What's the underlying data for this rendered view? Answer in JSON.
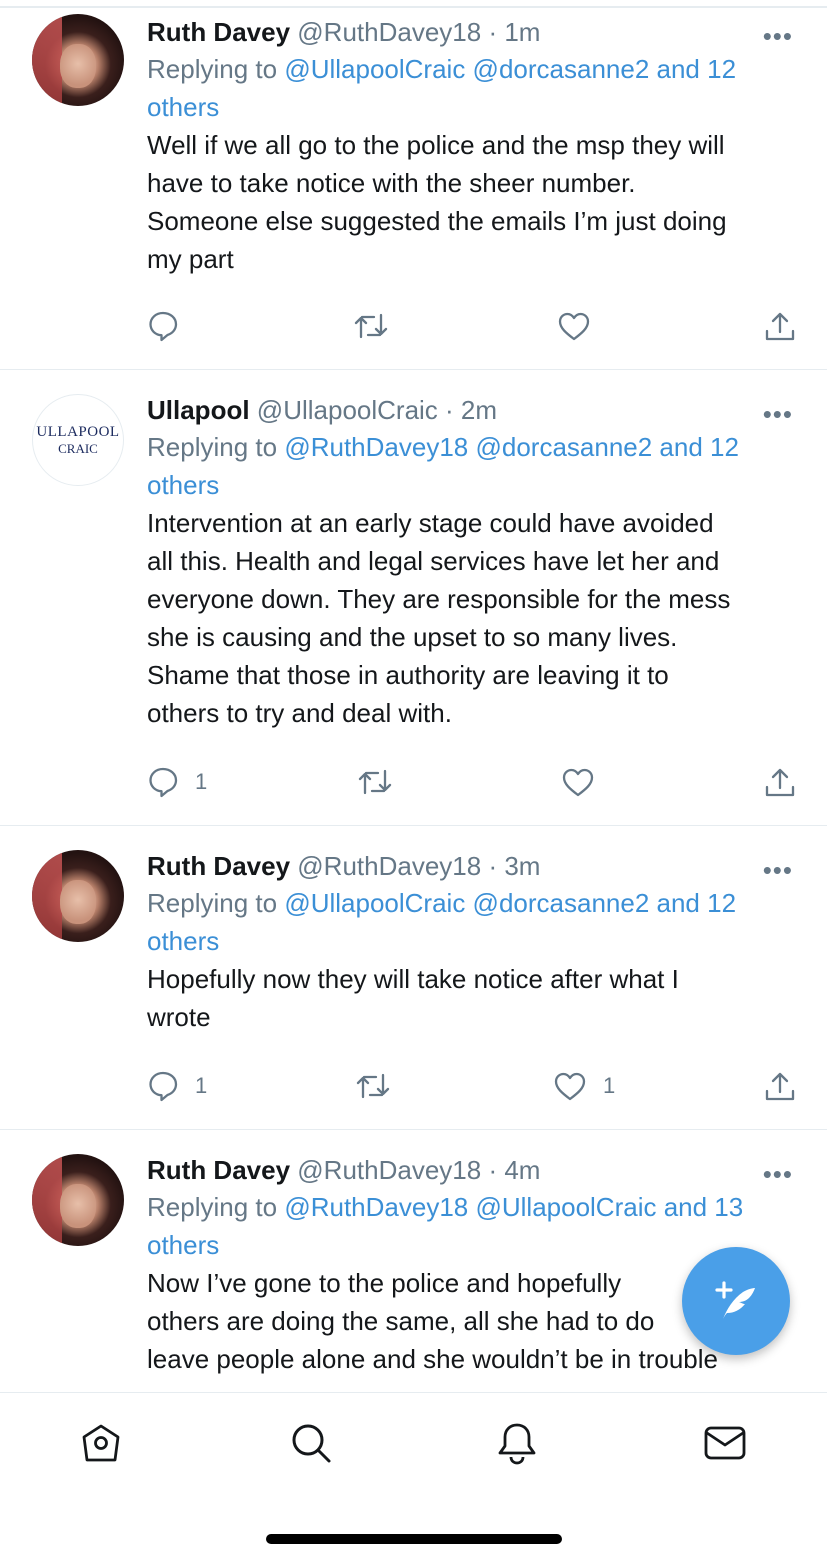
{
  "tweets": [
    {
      "name": "Ruth Davey",
      "handle": "@RuthDavey18",
      "time": "· 1m",
      "reply_prefix": "Replying to",
      "mentions": "@UllapoolCraic @dorcasanne2 and 12",
      "mentions_line2": "others",
      "lines": [
        "Well if we all go to the police and the msp they will",
        "have to take notice with the sheer number.",
        "Someone else suggested the emails I’m just doing",
        "my part"
      ],
      "reply_count": "",
      "like_count": "",
      "avatar": "ruth-avatar"
    },
    {
      "name": "Ullapool",
      "handle": "@UllapoolCraic",
      "time": "· 2m",
      "reply_prefix": "Replying to",
      "mentions": "@RuthDavey18 @dorcasanne2 and 12",
      "mentions_line2": "others",
      "lines": [
        "Intervention at an early stage could have avoided",
        "all this. Health and legal services have let her and",
        "everyone down. They are responsible for the mess",
        "she is causing and the upset to so many lives.",
        "Shame that those in authority are leaving it to",
        "others to try and deal with."
      ],
      "reply_count": "1",
      "like_count": "",
      "avatar": "ullapool-logo",
      "logo_line1": "ULLAPOOL",
      "logo_line2": "CRAIC"
    },
    {
      "name": "Ruth Davey",
      "handle": "@RuthDavey18",
      "time": "· 3m",
      "reply_prefix": "Replying to",
      "mentions": "@UllapoolCraic @dorcasanne2 and 12",
      "mentions_line2": "others",
      "lines": [
        "Hopefully now they will take notice after what I",
        "wrote"
      ],
      "reply_count": "1",
      "like_count": "1",
      "avatar": "ruth-avatar"
    },
    {
      "name": "Ruth Davey",
      "handle": "@RuthDavey18",
      "time": "· 4m",
      "reply_prefix": "Replying to",
      "mentions": "@RuthDavey18 @UllapoolCraic and 13",
      "mentions_line2": "others",
      "lines": [
        "Now I’ve gone to the police and hopefully",
        "others are doing the same, all she had to do",
        "leave people alone and she wouldn’t be in trouble"
      ],
      "reply_count": "",
      "like_count": "",
      "avatar": "ruth-avatar"
    }
  ],
  "more_glyph": "•••",
  "icons": {
    "reply": "reply-icon",
    "retweet": "retweet-icon",
    "like": "heart-icon",
    "share": "share-icon",
    "compose": "compose-tweet-icon",
    "nav": [
      "home-icon",
      "search-icon",
      "notifications-icon",
      "messages-icon"
    ]
  },
  "colors": {
    "link": "#3b8fd6",
    "muted": "#657786",
    "fab": "#4a9fe8"
  }
}
